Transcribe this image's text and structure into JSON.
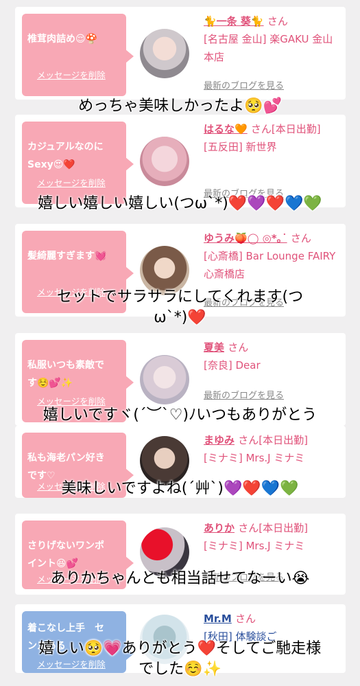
{
  "delete_label": "メッセージを削除",
  "blog_label": "最新のブログを見る",
  "cards": [
    {
      "bubble": "椎茸肉詰め😌🍄",
      "name": "🐈一条 葵🐈",
      "suffix": "さん",
      "shop": "[名古屋 金山] 楽GAKU 金山本店",
      "comment": "めっちゃ美味しかったよ🥺💕"
    },
    {
      "bubble": "カジュアルなのに\nSexy😍❤️",
      "name": "はるな🧡",
      "suffix": "さん[本日出勤]",
      "shop": "[五反田] 新世界",
      "comment": "嬉しい嬉しい嬉しい(つω`*)❤️💜❤️💙💚"
    },
    {
      "bubble": "髪綺麗すぎます💓",
      "name": "ゆうみ🍑◯ ◎*｡˙",
      "suffix": "さん",
      "shop": "[心斎橋] Bar Lounge FAIRY 心斎橋店",
      "comment": "セットでサラサラにしてくれます(つ\nω`*)❤️"
    },
    {
      "bubble": "私服いつも素敵で\nす☺️💕✨",
      "name": "夏美",
      "suffix": "さん",
      "shop": "[奈良] Dear",
      "comment": "嬉しいですヾ(´︶`♡)ﾉいつもありがとう"
    },
    {
      "bubble": "私も海老パン好き\nです♡",
      "name": "まゆみ",
      "suffix": "さん[本日出勤]",
      "shop": "[ミナミ] Mrs.J ミナミ",
      "comment": "美味しいですよね(´艸`)💜❤️💙💚"
    },
    {
      "bubble": "さりげないワンポ\nイント😆💕",
      "name": "ありか",
      "suffix": "さん[本日出勤]",
      "shop": "[ミナミ] Mrs.J ミナミ",
      "comment": "ありかちゃんとも相当話せてなーい😭"
    },
    {
      "bubble": "着こなし上手　セ\nンスある",
      "name": "Mr.M",
      "suffix": "さん",
      "shop": "[秋田] 体験談ご",
      "comment": "嬉しい🥺💗ありがとう❤️そしてご馳走様\nでした☺️✨"
    }
  ]
}
